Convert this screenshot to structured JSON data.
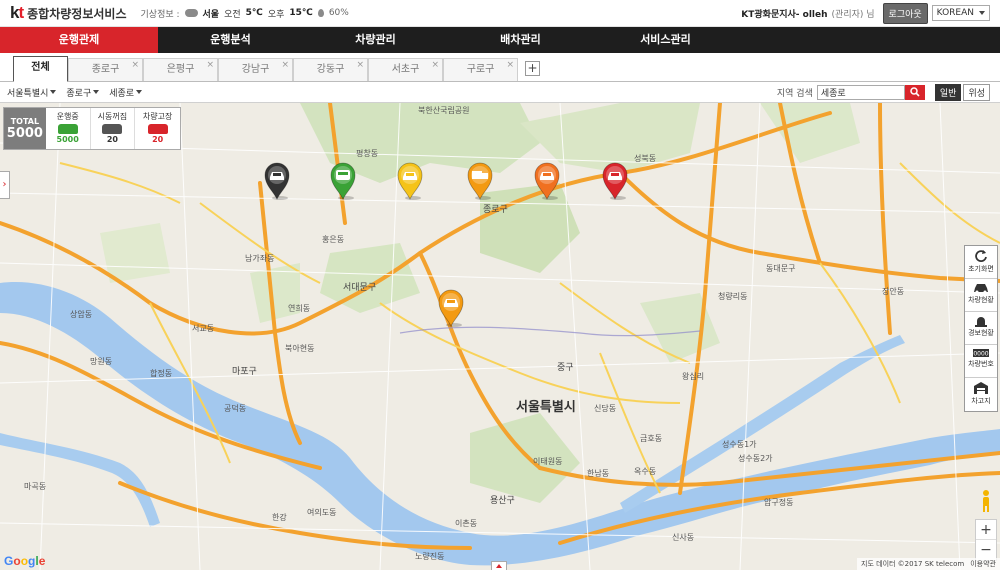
{
  "header": {
    "logo_kt": "kt",
    "service_name": "종합차량정보서비스",
    "weather_label": "기상정보 :",
    "city": "서울",
    "am_label": "오전",
    "am_temp": "5℃",
    "pm_label": "오후",
    "pm_temp": "15℃",
    "humidity": "60%",
    "user_name": "KT광화문지사- olleh",
    "user_role": "(관리자) 님",
    "logout_label": "로그아웃",
    "language": "KOREAN"
  },
  "nav": {
    "items": [
      {
        "label": "운행관제",
        "active": true
      },
      {
        "label": "운행분석",
        "active": false
      },
      {
        "label": "차량관리",
        "active": false
      },
      {
        "label": "배차관리",
        "active": false
      },
      {
        "label": "서비스관리",
        "active": false
      }
    ]
  },
  "tabs": {
    "items": [
      {
        "label": "전체",
        "active": true
      },
      {
        "label": "종로구"
      },
      {
        "label": "은평구"
      },
      {
        "label": "강남구"
      },
      {
        "label": "강동구"
      },
      {
        "label": "서초구"
      },
      {
        "label": "구로구"
      }
    ],
    "close_glyph": "×",
    "add_glyph": "+"
  },
  "filters": {
    "city": "서울특별시",
    "district": "종로구",
    "road": "세종로",
    "search_label": "지역 검색",
    "search_value": "세종로",
    "map_normal": "일반",
    "map_satellite": "위성"
  },
  "status": {
    "total_label": "TOTAL",
    "total_value": "5000",
    "running_label": "운행중",
    "running_value": "5000",
    "running_color": "#3aa236",
    "idle_label": "시동꺼짐",
    "idle_value": "20",
    "idle_color": "#555555",
    "fault_label": "차량고장",
    "fault_value": "20",
    "fault_color": "#d8252b"
  },
  "tools": [
    {
      "label": "초기화면",
      "icon": "refresh-icon"
    },
    {
      "label": "차량현황",
      "icon": "car-icon"
    },
    {
      "label": "경보현황",
      "icon": "alarm-icon"
    },
    {
      "label": "차량번호",
      "icon": "plate-icon"
    },
    {
      "label": "차고지",
      "icon": "garage-icon"
    }
  ],
  "map": {
    "city_label": "서울특별시",
    "gu_labels": [
      "종로구",
      "서대문구",
      "마포구",
      "용산구",
      "중구"
    ],
    "places": [
      "북한산국립공원",
      "평창동",
      "홍은동",
      "연희동",
      "성북동",
      "동대문구",
      "장안동",
      "한강",
      "여의도동",
      "이태원동",
      "한남동",
      "신사동",
      "압구정동",
      "성수동1가",
      "성수동2가",
      "금호동",
      "옥수동",
      "망원동",
      "합정동",
      "서교동",
      "노량진동",
      "이촌동",
      "신당동",
      "왕십리",
      "청량리동",
      "남가좌동",
      "북아현동",
      "공덕동",
      "마곡동",
      "상암동"
    ],
    "google": "Google",
    "attribution": [
      "지도 데이터 ©2017 SK telecom",
      "이용약관"
    ],
    "pins": [
      {
        "color": "#333333",
        "vehicle": "sedan"
      },
      {
        "color": "#3aa236",
        "vehicle": "bus"
      },
      {
        "color": "#f5c318",
        "vehicle": "sedan"
      },
      {
        "color": "#f39a12",
        "vehicle": "truck"
      },
      {
        "color": "#f07020",
        "vehicle": "sedan"
      },
      {
        "color": "#d8252b",
        "vehicle": "sedan"
      },
      {
        "color": "#f39a12",
        "vehicle": "sedan"
      }
    ]
  }
}
